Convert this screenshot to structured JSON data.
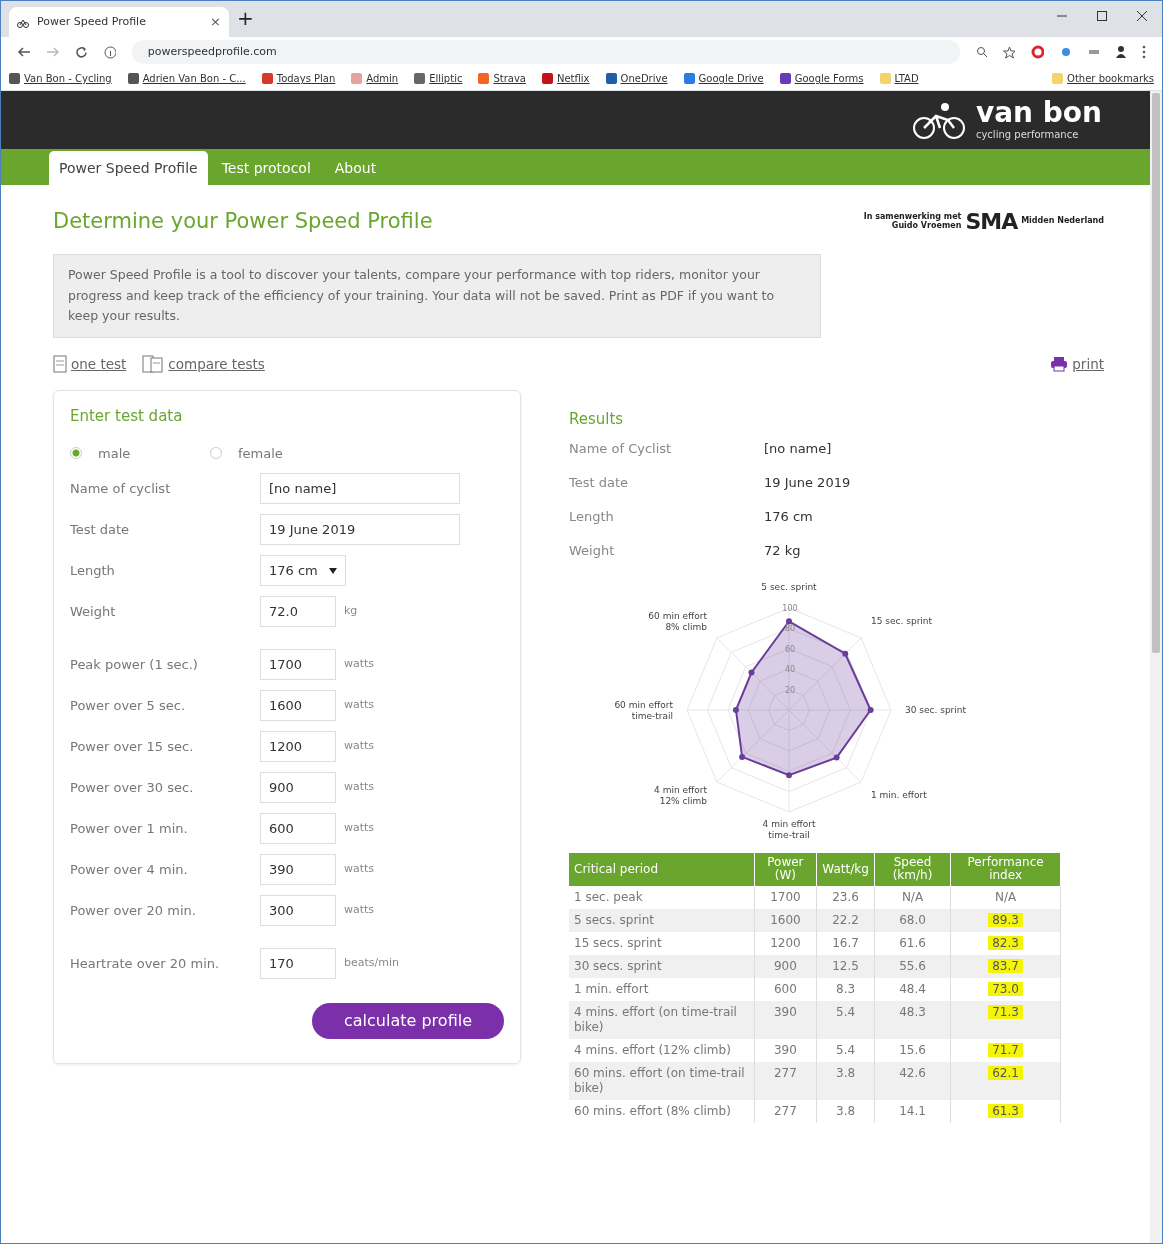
{
  "browser": {
    "tab_title": "Power Speed Profile",
    "tab_close": "×",
    "new_tab": "+",
    "url": "powerspeedprofile.com",
    "bookmarks": [
      {
        "label": "Van Bon - Cycling",
        "color": "#555555"
      },
      {
        "label": "Adrien Van Bon - C...",
        "color": "#555555"
      },
      {
        "label": "Todays Plan",
        "color": "#d33a2c"
      },
      {
        "label": "Admin",
        "color": "#e8a0a0"
      },
      {
        "label": "Elliptic",
        "color": "#666666"
      },
      {
        "label": "Strava",
        "color": "#f26522"
      },
      {
        "label": "Netflix",
        "color": "#c4111b"
      },
      {
        "label": "OneDrive",
        "color": "#1e5fa8"
      },
      {
        "label": "Google Drive",
        "color": "#2a7de1"
      },
      {
        "label": "Google Forms",
        "color": "#673ab7"
      },
      {
        "label": "LTAD",
        "color": "#f3d46b"
      }
    ],
    "other_bookmarks": "Other bookmarks"
  },
  "header": {
    "logo_text": "van bon",
    "logo_sub": "cycling performance"
  },
  "nav": [
    {
      "label": "Power Speed Profile",
      "selected": true
    },
    {
      "label": "Test protocol",
      "selected": false
    },
    {
      "label": "About",
      "selected": false
    }
  ],
  "page_title": "Determine your Power Speed Profile",
  "partner": {
    "line1": "In samenwerking met",
    "line2": "Guido Vroemen",
    "brand": "SMA",
    "region": "Midden Nederland"
  },
  "intro": "Power Speed Profile is a tool to discover your talents, compare your performance with top riders, monitor your progress and keep track of the efficiency of your training. Your data will not be saved. Print as PDF if you want to keep your results.",
  "views": [
    {
      "label": "one test"
    },
    {
      "label": "compare tests"
    }
  ],
  "print": "print",
  "form": {
    "title": "Enter test data",
    "gender": [
      {
        "label": "male",
        "selected": true
      },
      {
        "label": "female",
        "selected": false
      }
    ],
    "fields": [
      {
        "kind": "text",
        "label": "Name of cyclist",
        "value": "[no name]"
      },
      {
        "kind": "text",
        "label": "Test date",
        "value": "19 June 2019"
      },
      {
        "kind": "select",
        "label": "Length",
        "value": "176 cm"
      },
      {
        "kind": "number",
        "label": "Weight",
        "value": "72.0",
        "unit": "kg"
      }
    ],
    "power_fields": [
      {
        "kind": "number",
        "label": "Peak power (1 sec.)",
        "value": "1700",
        "unit": "watts"
      },
      {
        "kind": "number",
        "label": "Power over 5 sec.",
        "value": "1600",
        "unit": "watts"
      },
      {
        "kind": "number",
        "label": "Power over 15 sec.",
        "value": "1200",
        "unit": "watts"
      },
      {
        "kind": "number",
        "label": "Power over 30 sec.",
        "value": "900",
        "unit": "watts"
      },
      {
        "kind": "number",
        "label": "Power over 1 min.",
        "value": "600",
        "unit": "watts"
      },
      {
        "kind": "number",
        "label": "Power over 4 min.",
        "value": "390",
        "unit": "watts"
      },
      {
        "kind": "number",
        "label": "Power over 20 min.",
        "value": "300",
        "unit": "watts"
      }
    ],
    "heart_fields": [
      {
        "kind": "number",
        "label": "Heartrate over 20 min.",
        "value": "170",
        "unit": "beats/min"
      }
    ],
    "button": "calculate profile"
  },
  "results": {
    "title": "Results",
    "rows": [
      {
        "label": "Name of Cyclist",
        "value": "[no name]"
      },
      {
        "label": "Test date",
        "value": "19 June 2019"
      },
      {
        "label": "Length",
        "value": "176 cm"
      },
      {
        "label": "Weight",
        "value": "72 kg"
      }
    ],
    "radar": {
      "axis_labels": [
        "5 sec. sprint",
        "15 sec. sprint",
        "30 sec. sprint",
        "1 min. effort",
        "4 min effort\ntime-trail",
        "4 min effort\n12% climb",
        "60 min effort\ntime-trail",
        "60 min effort\n8% climb"
      ],
      "tick_labels": [
        "100",
        "80",
        "60",
        "40",
        "20"
      ]
    },
    "table": {
      "columns": [
        "Critical period",
        "Power (W)",
        "Watt/kg",
        "Speed (km/h)",
        "Performance index"
      ],
      "rows": [
        {
          "cells": [
            "1 sec. peak",
            "1700",
            "23.6",
            "N/A"
          ],
          "index": "N/A",
          "highlighted": false
        },
        {
          "cells": [
            "5 secs. sprint",
            "1600",
            "22.2",
            "68.0"
          ],
          "index": "89.3",
          "highlighted": true
        },
        {
          "cells": [
            "15 secs. sprint",
            "1200",
            "16.7",
            "61.6"
          ],
          "index": "82.3",
          "highlighted": true
        },
        {
          "cells": [
            "30 secs. sprint",
            "900",
            "12.5",
            "55.6"
          ],
          "index": "83.7",
          "highlighted": true
        },
        {
          "cells": [
            "1 min. effort",
            "600",
            "8.3",
            "48.4"
          ],
          "index": "73.0",
          "highlighted": true
        },
        {
          "cells": [
            "4 mins. effort (on time-trail bike)",
            "390",
            "5.4",
            "48.3"
          ],
          "index": "71.3",
          "highlighted": true
        },
        {
          "cells": [
            "4 mins. effort (12% climb)",
            "390",
            "5.4",
            "15.6"
          ],
          "index": "71.7",
          "highlighted": true
        },
        {
          "cells": [
            "60 mins. effort (on time-trail bike)",
            "277",
            "3.8",
            "42.6"
          ],
          "index": "62.1",
          "highlighted": true
        },
        {
          "cells": [
            "60 mins. effort (8% climb)",
            "277",
            "3.8",
            "14.1"
          ],
          "index": "61.3",
          "highlighted": true
        }
      ]
    }
  }
}
